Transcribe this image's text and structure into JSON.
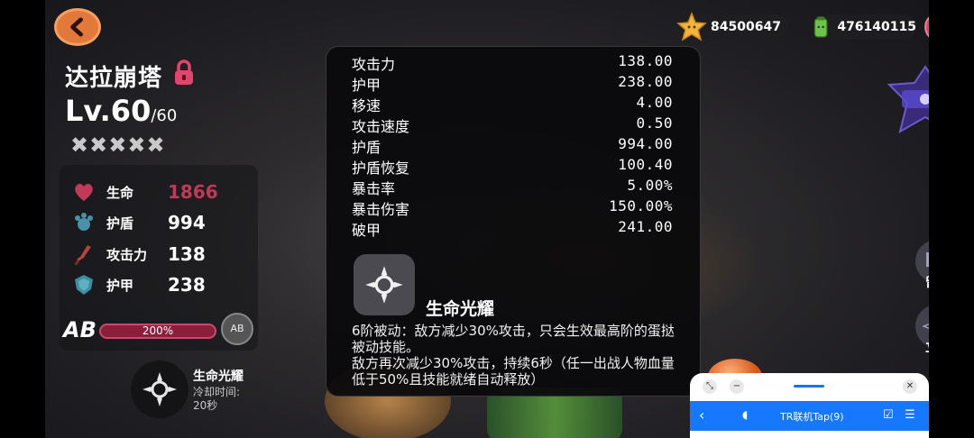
{
  "hero": {
    "name": "达拉崩塔",
    "level": "Lv.60",
    "level_max": "/60",
    "stars": "✖✖✖✖✖"
  },
  "stats": [
    {
      "label": "生命",
      "value": "1866",
      "icon": "heart-icon",
      "color": "#c13a57"
    },
    {
      "label": "护盾",
      "value": "994",
      "icon": "paw-shield-icon",
      "color": "#4a90a8"
    },
    {
      "label": "攻击力",
      "value": "138",
      "icon": "sword-icon",
      "color": "#b2453f"
    },
    {
      "label": "护甲",
      "value": "238",
      "icon": "armor-icon",
      "color": "#3d8ea0"
    }
  ],
  "ab": {
    "label": "AB",
    "percent_text": "200%",
    "badge": "AB"
  },
  "skill_small": {
    "name": "生命光耀",
    "cooldown_label": "冷却时间:",
    "cooldown_value": "20秒"
  },
  "currency": {
    "coins": "84500647",
    "energy": "476140115"
  },
  "help": "?",
  "side": {
    "message_label": "留言",
    "portrait_label": "立绘"
  },
  "popup": {
    "attributes": [
      {
        "label": "攻击力",
        "value": "138.00"
      },
      {
        "label": "护甲",
        "value": "238.00"
      },
      {
        "label": "移速",
        "value": "4.00"
      },
      {
        "label": "攻击速度",
        "value": "0.50"
      },
      {
        "label": "护盾",
        "value": "994.00"
      },
      {
        "label": "护盾恢复",
        "value": "100.40"
      },
      {
        "label": "暴击率",
        "value": "5.00%"
      },
      {
        "label": "暴击伤害",
        "value": "150.00%"
      },
      {
        "label": "破甲",
        "value": "241.00"
      }
    ],
    "skill_title": "生命光耀",
    "skill_desc_1": "6阶被动：敌方减少30%攻击，只会生效最高阶的蛋挞被动技能。",
    "skill_desc_2": "敌方再次减少30%攻击，持续6秒（任一出战人物血量低于50%且技能就绪自动释放）"
  },
  "overlay": {
    "title": "TR联机Tap(9)"
  },
  "colors": {
    "accent_orange": "#e2783a",
    "hp_red": "#c13a57",
    "overlay_blue": "#1677ff"
  }
}
